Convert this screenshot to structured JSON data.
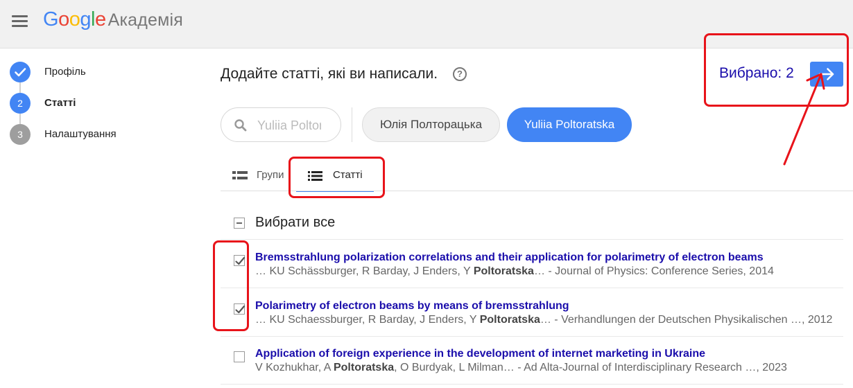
{
  "header": {
    "logo_parts": [
      "G",
      "o",
      "o",
      "g",
      "l",
      "e"
    ],
    "logo_product": "Академія"
  },
  "steps": [
    {
      "number": "",
      "label": "Профіль",
      "state": "done"
    },
    {
      "number": "2",
      "label": "Статті",
      "state": "current"
    },
    {
      "number": "3",
      "label": "Налаштування",
      "state": "pending"
    }
  ],
  "main": {
    "title": "Додайте статті, які ви написали.",
    "help_symbol": "?",
    "selected_count_text": "Вибрано: 2",
    "search": {
      "placeholder": "Yuliia Poltoratska"
    },
    "name_chips": [
      "Юлія Полторацька",
      "Yuliia Poltoratska"
    ],
    "tabs": [
      {
        "label": "Групи",
        "active": false
      },
      {
        "label": "Статті",
        "active": true
      }
    ],
    "select_all_label": "Вибрати все",
    "articles": [
      {
        "checked": true,
        "title": "Bremsstrahlung polarization correlations and their application for polarimetry of electron beams",
        "authors_before": "… KU Schässburger, R Barday, J Enders, Y ",
        "author_highlight": "Poltoratska",
        "authors_after": "… - Journal of Physics: Conference Series, 2014"
      },
      {
        "checked": true,
        "title": "Polarimetry of electron beams by means of bremsstrahlung",
        "authors_before": "… KU Schaessburger, R Barday, J Enders, Y ",
        "author_highlight": "Poltoratska",
        "authors_after": "… - Verhandlungen der Deutschen Physikalischen …, 2012"
      },
      {
        "checked": false,
        "title": "Application of foreign experience in the development of internet marketing in Ukraine",
        "authors_before": "V Kozhukhar, A ",
        "author_highlight": "Poltoratska",
        "authors_after": ", O Burdyak, L Milman… - Ad Alta-Journal of Interdisciplinary Research …, 2023"
      }
    ]
  },
  "colors": {
    "accent": "#4285f4",
    "link": "#1a0dab",
    "annotation": "#e8131a",
    "header_bg": "#f1f1f1"
  }
}
